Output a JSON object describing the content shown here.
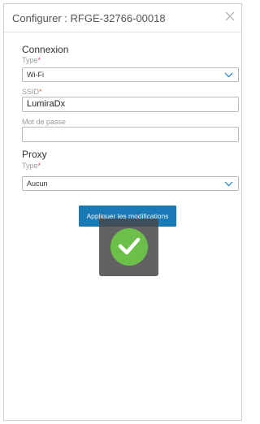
{
  "dialog": {
    "title": "Configurer : RFGE-32766-00018",
    "close_icon": "close-icon"
  },
  "connexion": {
    "heading": "Connexion",
    "type_label": "Type",
    "type_value": "Wi-Fi",
    "ssid_label": "SSID",
    "ssid_value": "LumiraDx",
    "password_label": "Mot de passe",
    "password_value": ""
  },
  "proxy": {
    "heading": "Proxy",
    "type_label": "Type",
    "type_value": "Aucun"
  },
  "required_marker": "*",
  "apply_label": "Appliquer les modifications",
  "success_icon": "checkmark-circle-icon",
  "colors": {
    "accent": "#1a7ab8",
    "success": "#6cc04a",
    "required": "#d9534f"
  }
}
